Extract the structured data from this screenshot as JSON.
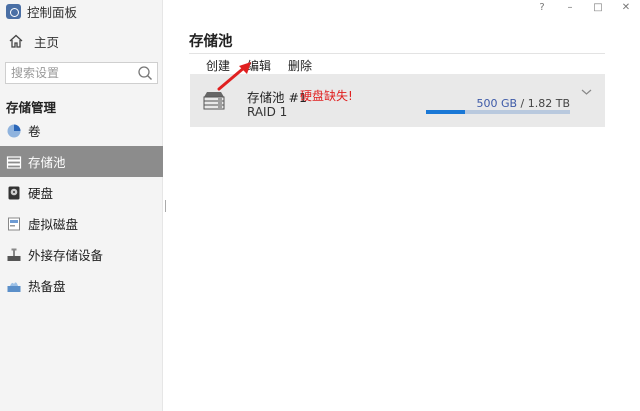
{
  "app": {
    "title": "控制面板",
    "icon": "control-panel-icon"
  },
  "window_controls": {
    "help": "?",
    "minimize": "–",
    "maximize": "□",
    "close": "✕"
  },
  "sidebar": {
    "home": {
      "label": "主页",
      "icon": "home-icon"
    },
    "search": {
      "placeholder": "搜索设置",
      "value": ""
    },
    "section": "存储管理",
    "items": [
      {
        "label": "卷",
        "icon": "volume-pie-icon",
        "active": false
      },
      {
        "label": "存储池",
        "icon": "storage-pool-icon",
        "active": true
      },
      {
        "label": "硬盘",
        "icon": "hard-disk-icon",
        "active": false
      },
      {
        "label": "虚拟磁盘",
        "icon": "virtual-disk-icon",
        "active": false
      },
      {
        "label": "外接存储设备",
        "icon": "external-storage-icon",
        "active": false
      },
      {
        "label": "热备盘",
        "icon": "hot-spare-icon",
        "active": false
      }
    ]
  },
  "main": {
    "title": "存储池",
    "toolbar": {
      "create": "创建",
      "edit": "编辑",
      "delete": "删除"
    },
    "pools": [
      {
        "name": "存储池 #1",
        "warning": "硬盘缺失!",
        "raid": "RAID 1",
        "used": "500 GB",
        "separator": " / ",
        "total": "1.82 TB",
        "usage_fraction": 0.27
      }
    ]
  },
  "colors": {
    "accent": "#1a78d6",
    "warning": "#e02020",
    "active_nav": "#8c8c8c",
    "arrow": "#e02020"
  }
}
